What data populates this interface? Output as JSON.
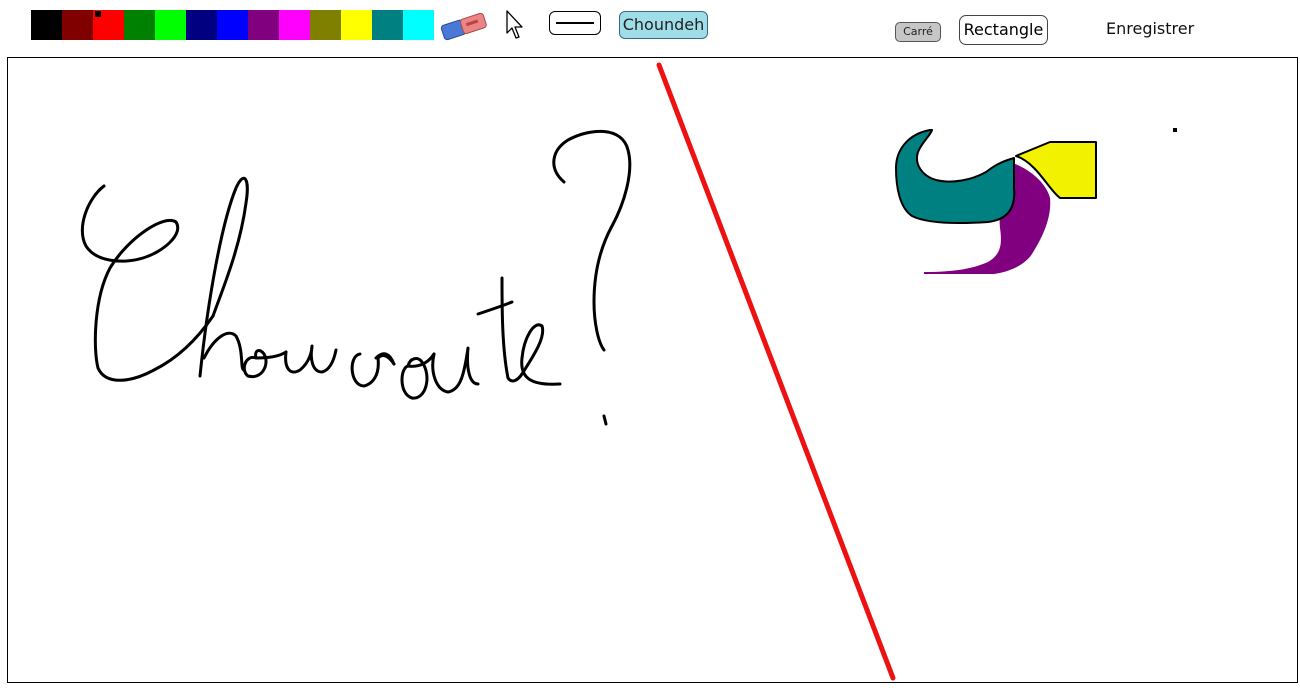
{
  "palette": [
    {
      "name": "black",
      "hex": "#000000"
    },
    {
      "name": "maroon",
      "hex": "#800000"
    },
    {
      "name": "red",
      "hex": "#ff0000"
    },
    {
      "name": "green",
      "hex": "#008000"
    },
    {
      "name": "lime",
      "hex": "#00ff00"
    },
    {
      "name": "navy",
      "hex": "#000080"
    },
    {
      "name": "blue",
      "hex": "#0000ff"
    },
    {
      "name": "purple",
      "hex": "#800080"
    },
    {
      "name": "magenta",
      "hex": "#ff00ff"
    },
    {
      "name": "olive",
      "hex": "#808000"
    },
    {
      "name": "yellow",
      "hex": "#ffff00"
    },
    {
      "name": "teal",
      "hex": "#008080"
    },
    {
      "name": "cyan",
      "hex": "#00ffff"
    }
  ],
  "selected_color": "red",
  "tools": {
    "eraser_icon": "eraser-icon",
    "cursor_icon": "cursor-arrow-icon",
    "line_icon": "line-width-icon"
  },
  "buttons": {
    "choundeh": "Choundeh",
    "carre": "Carré",
    "rectangle": "Rectangle",
    "save": "Enregistrer"
  },
  "canvas": {
    "stroke_colors": {
      "handwriting": "#000000",
      "line": "#ee1111",
      "teal_shape": "#008080",
      "yellow_shape": "#f2f200",
      "purple_shape": "#800080"
    }
  }
}
